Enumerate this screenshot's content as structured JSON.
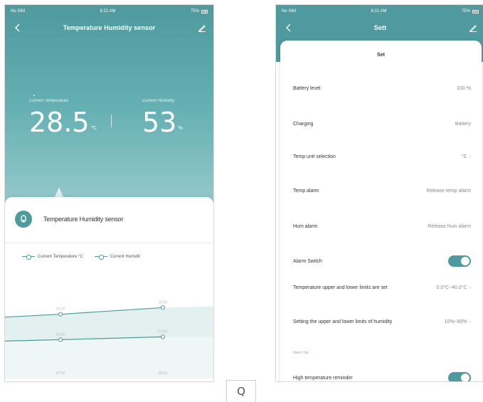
{
  "left": {
    "status": {
      "carrier": "No SIM",
      "time": "8:21 AM",
      "battery": "75%"
    },
    "nav": {
      "title": "Temperature Humidity sensor"
    },
    "readings": {
      "temperature": {
        "label": "Current Temperature",
        "value": "28.5",
        "unit": "°C"
      },
      "humidity": {
        "label": "Current Humidity",
        "value": "53",
        "unit": "%"
      }
    },
    "device": {
      "name": "Temperature Humidity sensor"
    },
    "chart_data": {
      "type": "line",
      "series": [
        {
          "name": "Current Temperature °C",
          "values": [
            26.5,
            28.5
          ]
        },
        {
          "name": "Current Humidit",
          "values": [
            41.0,
            51.0
          ]
        }
      ],
      "x": [
        "07:50",
        "08:00"
      ],
      "point_labels_top": [
        "26.50",
        "28.50"
      ],
      "point_labels_bottom": [
        "41.00",
        "51.00"
      ]
    }
  },
  "right": {
    "status": {
      "carrier": "No SIM",
      "time": "8:21 AM",
      "battery": "75%"
    },
    "nav": {
      "title": "Sett"
    },
    "sheet_title": "Set",
    "rows": [
      {
        "label": "Battery level",
        "value": "100 %"
      },
      {
        "label": "Charging",
        "value": "Battery"
      },
      {
        "label": "Temp unit selection",
        "value": "°C"
      },
      {
        "label": "Temp alarm",
        "value": "Release temp alarm"
      },
      {
        "label": "Hum alarm",
        "value": "Release hum alarm"
      },
      {
        "label": "Alarm Switch",
        "value": ""
      },
      {
        "label": "Temperature upper and lower limits are set",
        "value": "0.0°C~40.0°C"
      },
      {
        "label": "Setting the upper and lower limits of humidity",
        "value": "10%~80%"
      },
      {
        "label": "High temperature reminder",
        "value": ""
      }
    ],
    "section_small": "Alarm Set"
  },
  "search": {
    "glyph": "Q"
  },
  "colors": {
    "accent": "#4f9a9e",
    "hero_light": "#9ccdcf",
    "text": "#333333"
  },
  "icons": {
    "back": "chevron-left-icon",
    "edit": "pencil-icon",
    "device": "sensor-icon",
    "search": "search-icon"
  }
}
